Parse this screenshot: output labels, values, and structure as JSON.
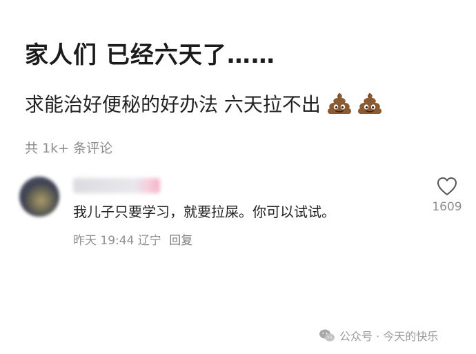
{
  "post": {
    "title": "家人们 已经六天了……",
    "body": "求能治好便秘的好办法 六天拉不出",
    "body_emojis": [
      "poop-emoji",
      "poop-emoji"
    ],
    "comment_count": "共 1k+ 条评论"
  },
  "comment": {
    "text": "我儿子只要学习，就要拉屎。你可以试试。",
    "time": "昨天 19:44",
    "location": "辽宁",
    "reply_label": "回复",
    "like_count": "1609"
  },
  "watermark": {
    "text": "公众号 · 今天的快乐"
  }
}
